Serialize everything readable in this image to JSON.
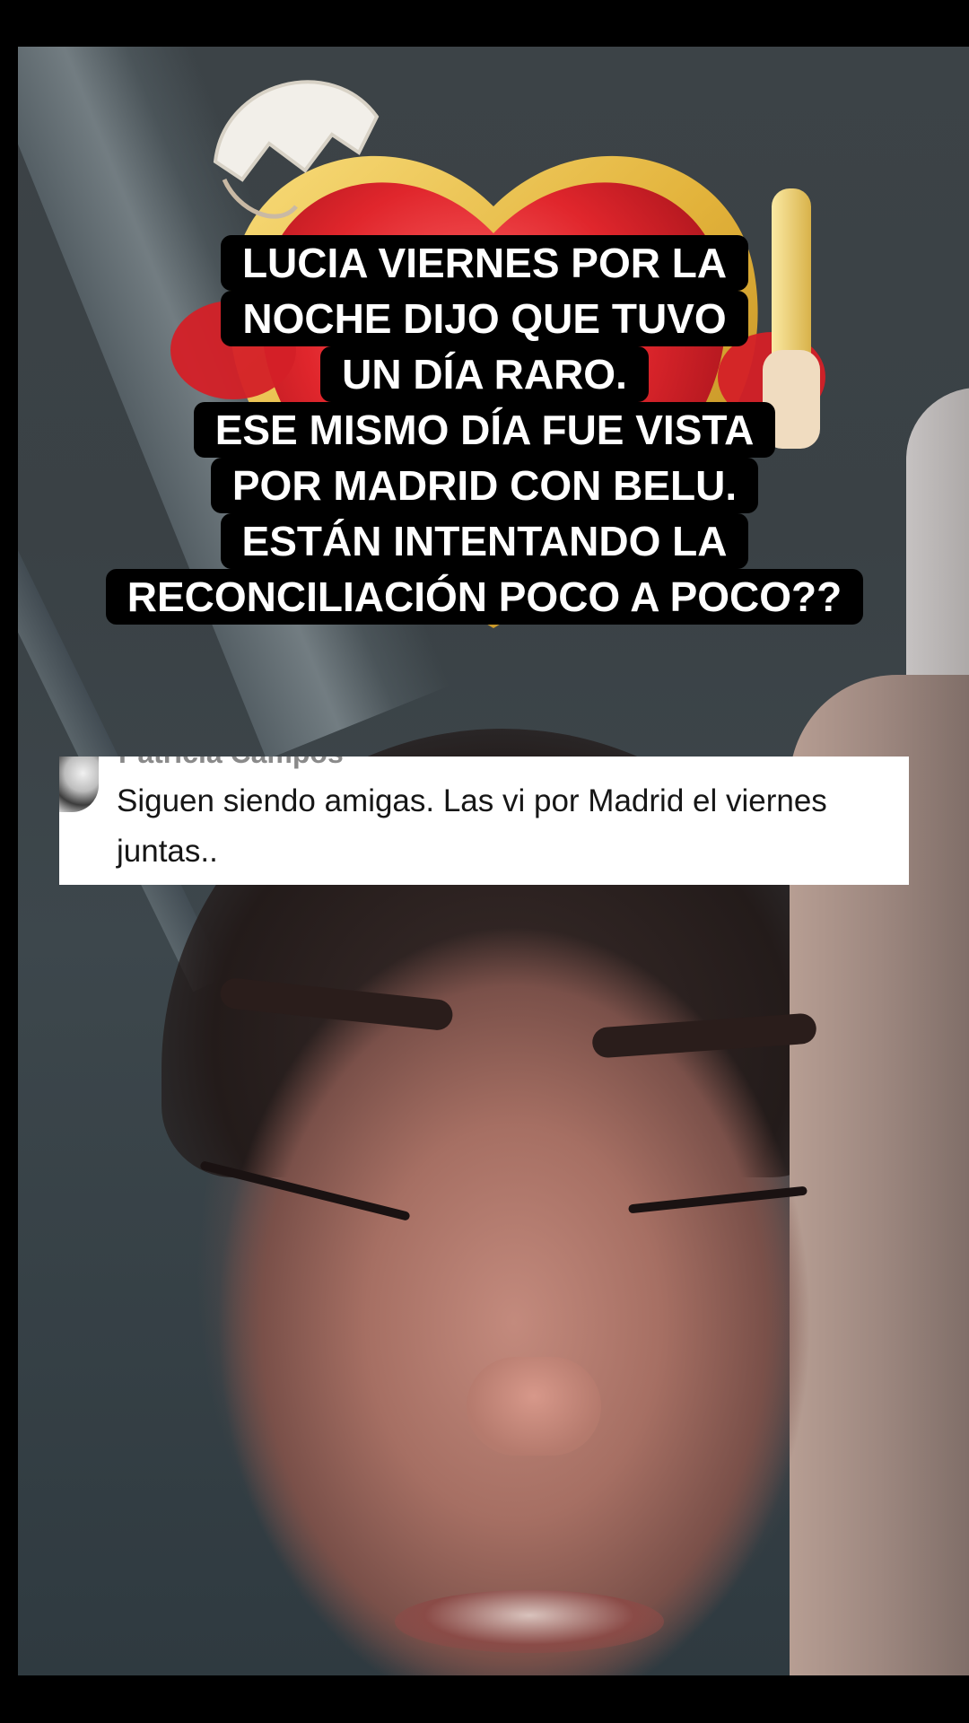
{
  "caption": {
    "lines": [
      "LUCIA VIERNES POR LA",
      "NOCHE DIJO QUE TUVO",
      "UN DÍA RARO.",
      "ESE MISMO DÍA FUE VISTA",
      "POR MADRID CON BELU.",
      "ESTÁN INTENTANDO LA",
      "RECONCILIACIÓN POCO A POCO??"
    ]
  },
  "comment": {
    "author": "Patricia Campos",
    "text": "Siguen siendo amigas. Las vi por Madrid el viernes juntas.."
  },
  "sticker": {
    "icon": "heart-lock-icon",
    "colors": {
      "heart": "#e0262c",
      "gold": "#e2b23a",
      "key": "#f3d56b"
    }
  },
  "colors": {
    "caption_bg": "#000000",
    "caption_text": "#ffffff",
    "comment_bg": "#ffffff",
    "comment_text": "#161616"
  }
}
